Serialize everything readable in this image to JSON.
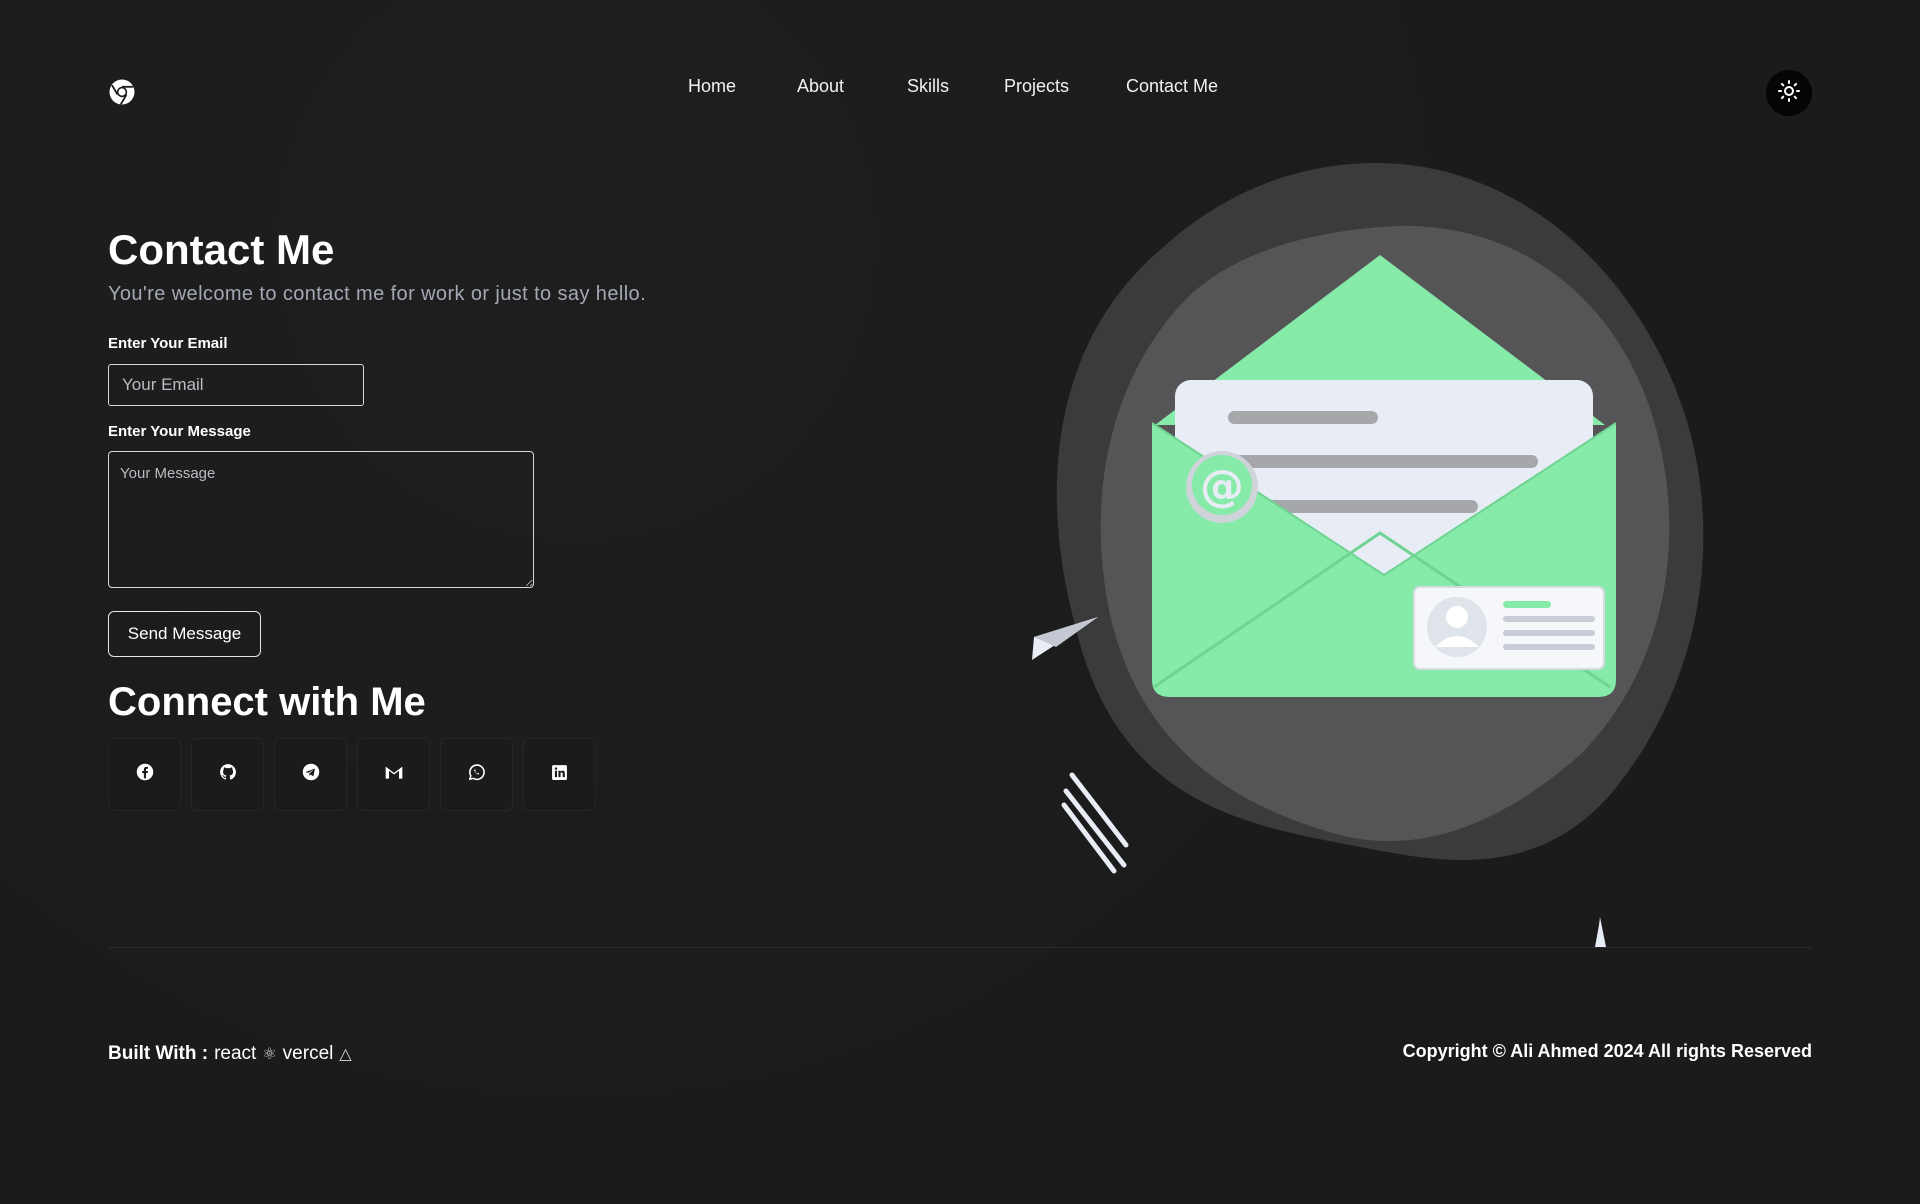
{
  "header": {
    "logo_icon": "chrome-logo-icon",
    "nav": [
      {
        "label": "Home"
      },
      {
        "label": "About"
      },
      {
        "label": "Skills"
      },
      {
        "label": "Projects"
      },
      {
        "label": "Contact Me"
      }
    ],
    "theme_toggle_icon": "sun-icon"
  },
  "contact": {
    "title": "Contact Me",
    "subtitle": "You're welcome to contact me for work or just to say hello.",
    "email_label": "Enter Your Email",
    "email_placeholder": "Your Email",
    "email_value": "",
    "message_label": "Enter Your Message",
    "message_placeholder": "Your Message",
    "message_value": "",
    "send_label": "Send Message"
  },
  "connect": {
    "title": "Connect with Me",
    "socials": [
      {
        "icon": "facebook-icon"
      },
      {
        "icon": "github-icon"
      },
      {
        "icon": "telegram-icon"
      },
      {
        "icon": "gmail-icon"
      },
      {
        "icon": "whatsapp-icon"
      },
      {
        "icon": "linkedin-icon"
      }
    ]
  },
  "illustration": {
    "icon": "envelope-illustration",
    "accent": "#86eba8"
  },
  "footer": {
    "built_with_label": "Built With :",
    "tech_1": "react",
    "tech_1_glyph": "⚛",
    "tech_2": "vercel",
    "tech_2_glyph": "△",
    "copyright": "Copyright © Ali Ahmed 2024 All rights Reserved"
  },
  "colors": {
    "background": "#1b1b1c",
    "text": "#ffffff",
    "muted": "#a3a8b4",
    "accent": "#86eba8"
  }
}
